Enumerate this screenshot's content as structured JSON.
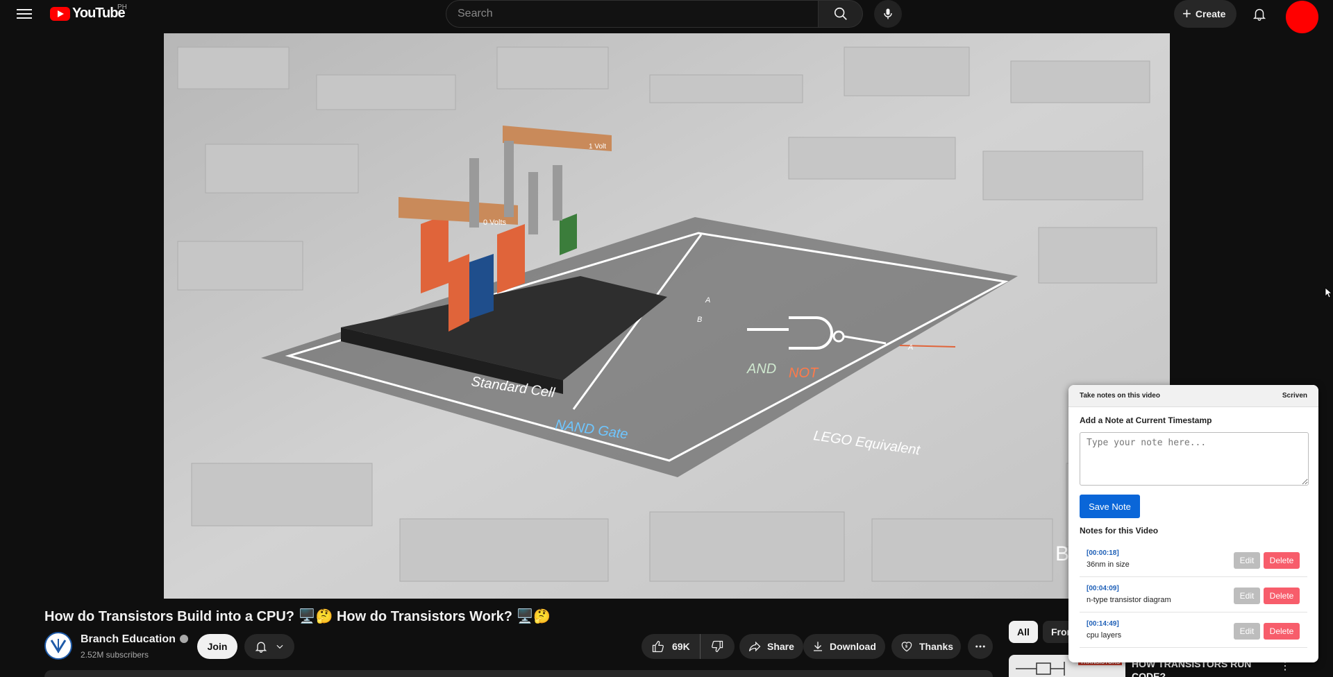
{
  "header": {
    "logo_text": "YouTube",
    "region": "PH",
    "search_placeholder": "Search",
    "create_label": "Create"
  },
  "video": {
    "title": "How do Transistors Build into a CPU? 🖥️🤔 How do Transistors Work? 🖥️🤔",
    "frame_labels": {
      "one_volt": "1 Volt",
      "zero_volts": "0 Volts",
      "standard_cell": "Standard Cell",
      "nand_gate": "NAND Gate",
      "and": "AND",
      "not": "NOT",
      "lego_equivalent": "LEGO Equivalent",
      "a_in": "A",
      "b_in": "B",
      "a_out": "A",
      "watermark": "B E"
    }
  },
  "channel": {
    "name": "Branch Education",
    "subscribers": "2.52M subscribers",
    "join_label": "Join"
  },
  "actions": {
    "likes": "69K",
    "share_label": "Share",
    "download_label": "Download",
    "thanks_label": "Thanks"
  },
  "sidebar": {
    "chips": [
      "All",
      "From"
    ],
    "rec_title": "HOW TRANSISTORS RUN CODE?",
    "rec_thumb_label": "TRANSISTORS"
  },
  "notes_panel": {
    "title": "Take notes on this video",
    "brand": "Scriven",
    "add_label": "Add a Note at Current Timestamp",
    "placeholder": "Type your note here...",
    "save_label": "Save Note",
    "list_label": "Notes for this Video",
    "edit_label": "Edit",
    "delete_label": "Delete",
    "notes": [
      {
        "timestamp": "[00:00:18]",
        "text": "36nm in size"
      },
      {
        "timestamp": "[00:04:09]",
        "text": "n-type transistor diagram"
      },
      {
        "timestamp": "[00:14:49]",
        "text": "cpu layers"
      }
    ]
  },
  "colors": {
    "background": "#0f0f0f",
    "brand_red": "#ff0000",
    "save_blue": "#0a66d8",
    "delete_red": "#f75d6b",
    "timestamp_blue": "#1d5fb7"
  }
}
